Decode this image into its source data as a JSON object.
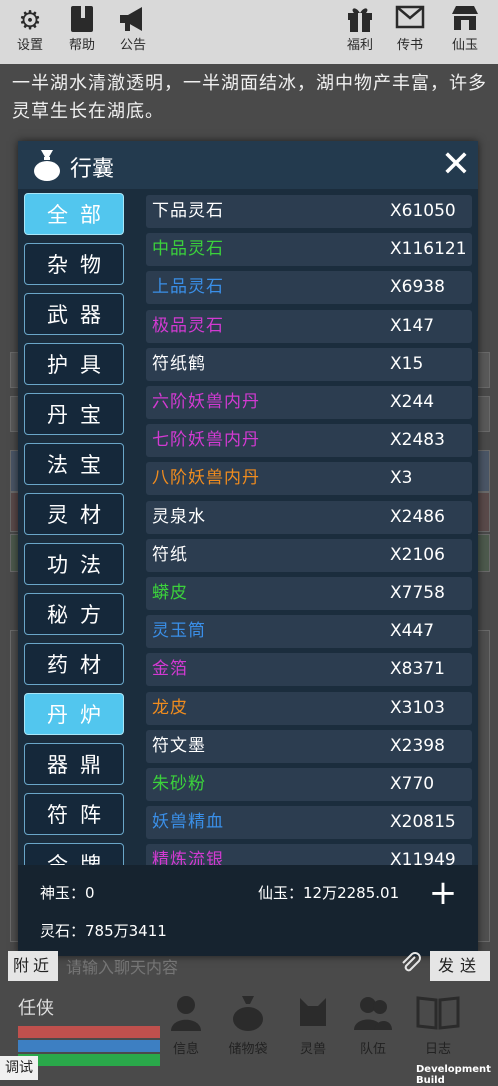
{
  "topbar": {
    "left": [
      {
        "name": "settings",
        "label": "设置",
        "icon": "gear-icon"
      },
      {
        "name": "help",
        "label": "帮助",
        "icon": "book-icon"
      },
      {
        "name": "announce",
        "label": "公告",
        "icon": "megaphone-icon"
      }
    ],
    "right": [
      {
        "name": "welfare",
        "label": "福利",
        "icon": "gift-icon"
      },
      {
        "name": "mail",
        "label": "传书",
        "icon": "mail-icon"
      },
      {
        "name": "xianyu",
        "label": "仙玉",
        "icon": "shop-icon"
      }
    ]
  },
  "scene_text": "一半湖水清澈透明，一半湖面结冰，湖中物产丰富，许多灵草生长在湖底。",
  "inventory": {
    "title": "行囊",
    "categories": [
      {
        "label": "全部",
        "active": true
      },
      {
        "label": "杂物",
        "active": false
      },
      {
        "label": "武器",
        "active": false
      },
      {
        "label": "护具",
        "active": false
      },
      {
        "label": "丹宝",
        "active": false
      },
      {
        "label": "法宝",
        "active": false
      },
      {
        "label": "灵材",
        "active": false
      },
      {
        "label": "功法",
        "active": false
      },
      {
        "label": "秘方",
        "active": false
      },
      {
        "label": "药材",
        "active": false
      },
      {
        "label": "丹炉",
        "active": true
      },
      {
        "label": "器鼎",
        "active": false
      },
      {
        "label": "符阵",
        "active": false
      },
      {
        "label": "令牌",
        "active": false
      }
    ],
    "items": [
      {
        "name": "下品灵石",
        "count": "X61050",
        "color": "#ffffff"
      },
      {
        "name": "中品灵石",
        "count": "X116121",
        "color": "#3bd23b"
      },
      {
        "name": "上品灵石",
        "count": "X6938",
        "color": "#3a8fe8"
      },
      {
        "name": "极品灵石",
        "count": "X147",
        "color": "#d23ad2"
      },
      {
        "name": "符纸鹤",
        "count": "X15",
        "color": "#ffffff"
      },
      {
        "name": "六阶妖兽内丹",
        "count": "X244",
        "color": "#d23ad2"
      },
      {
        "name": "七阶妖兽内丹",
        "count": "X2483",
        "color": "#d23ad2"
      },
      {
        "name": "八阶妖兽内丹",
        "count": "X3",
        "color": "#f08c1e"
      },
      {
        "name": "灵泉水",
        "count": "X2486",
        "color": "#ffffff"
      },
      {
        "name": "符纸",
        "count": "X2106",
        "color": "#ffffff"
      },
      {
        "name": "蟒皮",
        "count": "X7758",
        "color": "#3bd23b"
      },
      {
        "name": "灵玉筒",
        "count": "X447",
        "color": "#3a8fe8"
      },
      {
        "name": "金箔",
        "count": "X8371",
        "color": "#d23ad2"
      },
      {
        "name": "龙皮",
        "count": "X3103",
        "color": "#f08c1e"
      },
      {
        "name": "符文墨",
        "count": "X2398",
        "color": "#ffffff"
      },
      {
        "name": "朱砂粉",
        "count": "X770",
        "color": "#3bd23b"
      },
      {
        "name": "妖兽精血",
        "count": "X20815",
        "color": "#3a8fe8"
      },
      {
        "name": "精炼流银",
        "count": "X11949",
        "color": "#d23ad2"
      }
    ],
    "footer": {
      "shenyu": "神玉：0",
      "xianyu": "仙玉：12万2285.01",
      "lingshi": "灵石：785万3411"
    }
  },
  "chat": {
    "near_label": "附近",
    "placeholder": "请输入聊天内容",
    "send_label": "发送"
  },
  "bottom": {
    "role": "任侠",
    "bars": [
      "#c0504d",
      "#3d7fc2",
      "#2aa84a"
    ],
    "nav": [
      {
        "name": "info",
        "label": "信息",
        "icon": "person-icon"
      },
      {
        "name": "storage",
        "label": "储物袋",
        "icon": "bag-icon"
      },
      {
        "name": "beast",
        "label": "灵兽",
        "icon": "cat-icon"
      },
      {
        "name": "team",
        "label": "队伍",
        "icon": "group-icon"
      },
      {
        "name": "log",
        "label": "日志",
        "icon": "open-book-icon"
      }
    ],
    "debug_label": "调试",
    "dev_build": "Development Build"
  }
}
